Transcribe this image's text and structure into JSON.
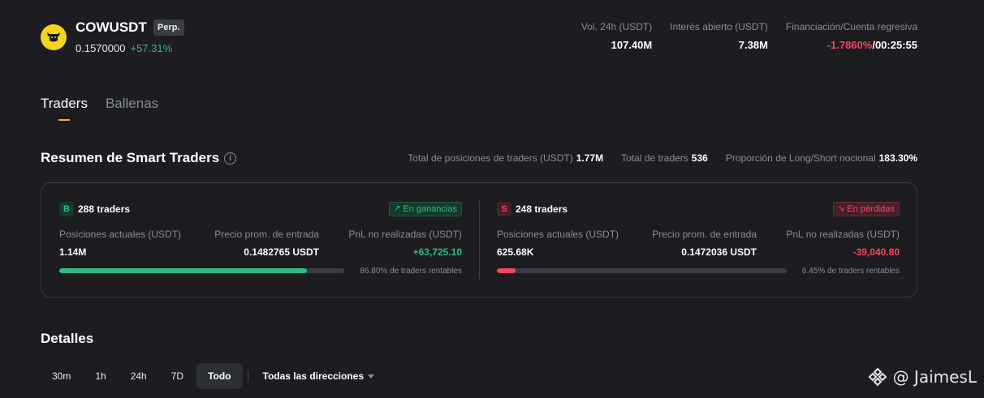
{
  "header": {
    "symbol": "COWUSDT",
    "badge": "Perp.",
    "price": "0.1570000",
    "change": "+57.31%",
    "stats": [
      {
        "label": "Vol. 24h (USDT)",
        "value": "107.40M"
      },
      {
        "label": "Interés abierto (USDT)",
        "value": "7.38M"
      },
      {
        "label": "Financiación/Cuenta regresiva",
        "funding": "-1.7860%",
        "separator": "/",
        "countdown": "00:25:55"
      }
    ],
    "colors": {
      "positive": "#2ebd85",
      "negative": "#f6465d",
      "accent": "#f0b90b",
      "coin": "#f5d41f"
    }
  },
  "tabs": [
    {
      "label": "Traders",
      "active": true
    },
    {
      "label": "Ballenas",
      "active": false
    }
  ],
  "summary": {
    "title": "Resumen de Smart Traders",
    "info_icon": "info-icon",
    "stats": [
      {
        "label": "Total de posiciones de traders (USDT)",
        "value": "1.77M"
      },
      {
        "label": "Total de traders",
        "value": "536"
      },
      {
        "label": "Proporción de Long/Short nocional",
        "value": "183.30%"
      }
    ],
    "long": {
      "badge": "B",
      "traders": "288 traders",
      "tag": "En ganancias",
      "tag_icon": "trend-up-icon",
      "positions_label": "Posiciones actuales (USDT)",
      "positions_value": "1.14M",
      "entry_label": "Precio prom. de entrada",
      "entry_value": "0.1482765 USDT",
      "pnl_label": "PnL no realizadas (USDT)",
      "pnl_value": "+63,725.10",
      "profitable_pct": 86.8,
      "profitable_text": "86.80% de traders rentables"
    },
    "short": {
      "badge": "S",
      "traders": "248 traders",
      "tag": "En pérdidas",
      "tag_icon": "trend-down-icon",
      "positions_label": "Posiciones actuales (USDT)",
      "positions_value": "625.68K",
      "entry_label": "Precio prom. de entrada",
      "entry_value": "0.1472036 USDT",
      "pnl_label": "PnL no realizadas (USDT)",
      "pnl_value": "-39,040.80",
      "profitable_pct": 6.45,
      "profitable_text": "6.45% de traders rentables"
    }
  },
  "details": {
    "title": "Detalles",
    "filters": [
      {
        "label": "30m",
        "active": false
      },
      {
        "label": "1h",
        "active": false
      },
      {
        "label": "24h",
        "active": false
      },
      {
        "label": "7D",
        "active": false
      },
      {
        "label": "Todo",
        "active": true
      }
    ],
    "direction": "Todas las direcciones"
  },
  "watermark": "@ JaimesL"
}
